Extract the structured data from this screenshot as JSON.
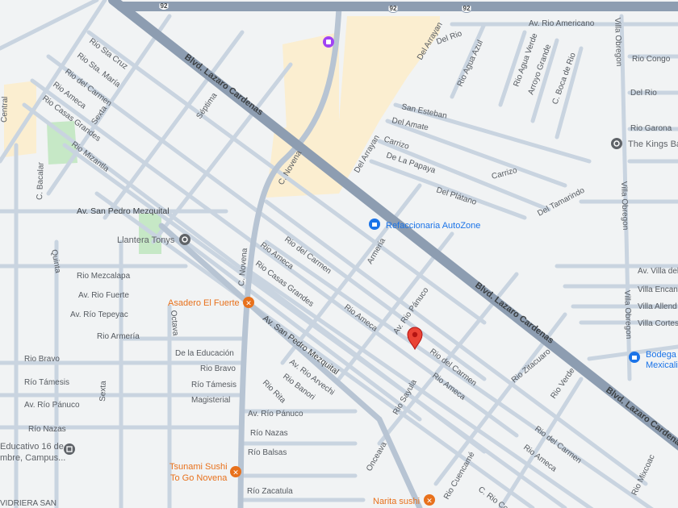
{
  "highway": {
    "name": "Blvd. Lazaro Cardenas",
    "route": "92"
  },
  "streets": {
    "rio_sta_cruz": "Rio Sta Cruz",
    "rio_sta_maria": "Rio Sta. María",
    "rio_del_carmen_nw": "Rio del Carmen",
    "rio_ameca_nw": "Rio Ameca",
    "rio_casas_grandes_nw": "Rio Casas Grandes",
    "sexta_n": "Sexta",
    "rio_mizantla": "Rio Mizantla",
    "central": "Central",
    "bacalar": "C. Bacalar",
    "septima": "Séptima",
    "c_novena_n": "C. Novena",
    "c_novena_s": "C. Novena",
    "av_san_pedro_w": "Av. San Pedro Mezquital",
    "av_san_pedro_s": "Av. San Pedro Mezquital",
    "quinta": "Quinta",
    "rio_mezcalapa": "Rio Mezcalapa",
    "rio_fuerte": "Av. Rio Fuerte",
    "rio_tepeyac": "Av. Río Tepeyac",
    "rio_armeria": "Rio Armería",
    "octava": "Octava",
    "de_la_educacion": "De la Educación",
    "rio_bravo_w": "Rio Bravo",
    "rio_bravo_e": "Rio Bravo",
    "rio_tamesis_w": "Río Támesis",
    "rio_tamesis_e": "Río Támesis",
    "av_rio_panuco_w": "Av. Río Pánuco",
    "magisterial": "Magisterial",
    "sexta_s": "Sexta",
    "rio_nazas_w": "Río Nazas",
    "rio_nazas_e": "Río Nazas",
    "av_rio_panuco_s": "Av. Río Pánuco",
    "rio_balsas": "Río Balsas",
    "rio_zacatula": "Río Zacatula",
    "rio_del_carmen_c": "Rio del Carmen",
    "rio_ameca_c": "Rio Ameca",
    "rio_casas_grandes_c": "Rio Casas Grandes",
    "armeria": "Armeria",
    "rio_ameca_c2": "Rio Ameca",
    "av_rio_panuco_diag": "Av. Rio Pánuco",
    "av_rio_arvechi": "Av. Rio Arvechi",
    "rio_banori": "Rio Banori",
    "rio_rita": "Rio Rita",
    "rio_del_carmen_se": "Rio del Carmen",
    "rio_ameca_se": "Rio Ameca",
    "rio_sayula": "Rio Sayula",
    "onceava": "Onceava",
    "rio_cuencame": "Rio Cuencamé",
    "rio_cono": "C. Rio Conc",
    "rio_zitacuaro": "Rio Zitacuaro",
    "rio_verde": "Rio Verde",
    "rio_del_carmen_fse": "Rio del Carmen",
    "rio_ameca_fse": "Rio Ameca",
    "rio_mixcoac": "Rio Mixcoac",
    "del_arrayan_n": "Del Arrayan",
    "del_arrayan_s": "Del Arrayan",
    "del_rio_n": "Del Rio",
    "av_rio_americano": "Av. Rio Americano",
    "rio_agua_azul": "Rio Agua Azul",
    "rio_agua_verde": "Rio Agua Verde",
    "arroyo_grande": "Arroyo Grande",
    "c_boca_de_rio": "C. Boca de Rio",
    "villa_obregon_n": "Villa Obregon",
    "rio_congo": "Rio Congo",
    "del_rio_e": "Del Rio",
    "san_esteban": "San Esteban",
    "del_amate": "Del Amate",
    "carrizo": "Carrizo",
    "de_la_papaya": "De La Papaya",
    "carrizo_2": "Carrizo",
    "del_platano": "Del Plátano",
    "del_tamarindo": "Del Tamarindo",
    "rio_garona": "Rio Garona",
    "villa_obregon_c": "Villa Obregon",
    "villa_obregon_s": "Villa Obregon",
    "av_villa_del": "Av. Villa del",
    "villa_encant": "Villa Encant",
    "villa_allend": "Villa Allend",
    "villa_cortes": "Villa Cortes"
  },
  "pois": {
    "llantera": "Llantera Tonys",
    "autozone": "Refaccionaria AutoZone",
    "asadero": "Asadero El Fuerte",
    "tsunami_1": "Tsunami Sushi",
    "tsunami_2": "To Go Novena",
    "narita": "Narita sushi",
    "kings": "The Kings Ba",
    "bodega_1": "Bodega",
    "bodega_2": "Mexicali",
    "school_1": "Educativo 16 de",
    "school_2": "mbre, Campus...",
    "vidriera": "VIDRIERA SAN"
  },
  "colors": {
    "background": "#f1f3f4",
    "road": "#c9d4e0",
    "highway": "#8d9db1",
    "commercial": "#fbeed0",
    "park": "#c6e8c6",
    "pin": "#ea4335",
    "poi_orange": "#e8711c",
    "poi_blue": "#1a73e8",
    "poi_grey": "#5f6368",
    "poi_purple": "#a142f4"
  },
  "icons": {
    "pin": "map-pin-icon",
    "shopping": "shopping-icon",
    "store": "store-icon",
    "restaurant": "restaurant-icon",
    "place": "place-icon",
    "school": "school-icon"
  }
}
